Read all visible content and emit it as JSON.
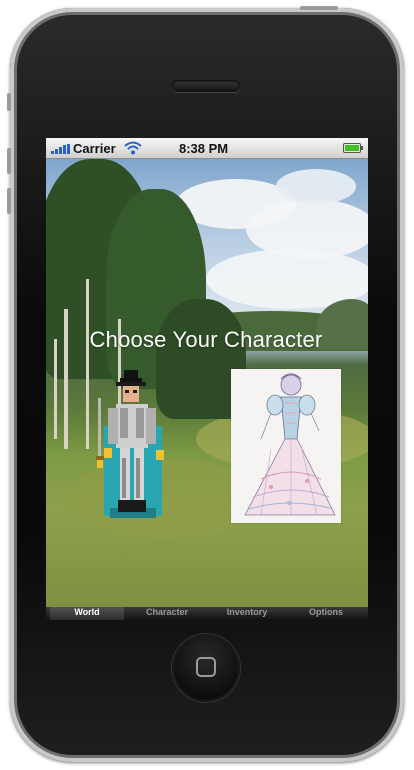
{
  "status_bar": {
    "carrier": "Carrier",
    "time": "8:38 PM"
  },
  "screen": {
    "title": "Choose Your Character"
  },
  "characters": [
    {
      "name": "knight",
      "icon": "knight-sprite"
    },
    {
      "name": "lady",
      "icon": "lady-gown-sketch"
    }
  ],
  "tab_bar": {
    "tabs": [
      {
        "label": "World",
        "active": true
      },
      {
        "label": "Character",
        "active": false
      },
      {
        "label": "Inventory",
        "active": false
      },
      {
        "label": "Options",
        "active": false
      }
    ]
  },
  "colors": {
    "tab_active_text": "#ffffff",
    "tab_inactive_text": "#9a9a9a",
    "battery_fill": "#3fc21f"
  }
}
